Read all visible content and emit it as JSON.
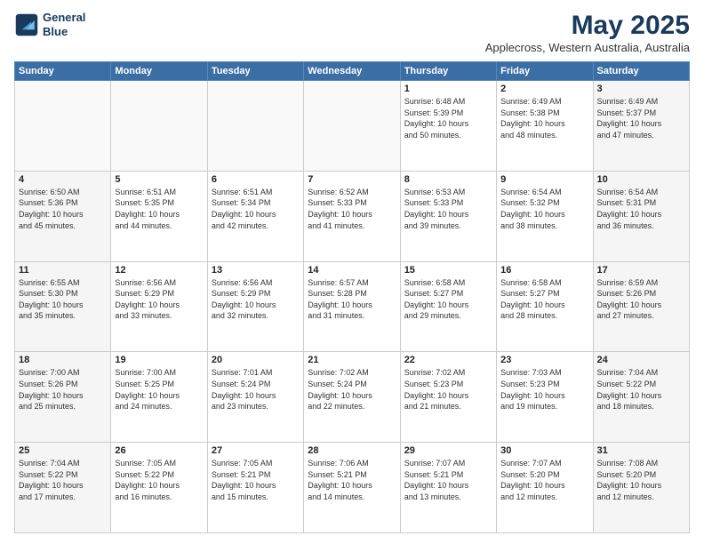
{
  "header": {
    "logo_line1": "General",
    "logo_line2": "Blue",
    "title": "May 2025",
    "location": "Applecross, Western Australia, Australia"
  },
  "weekdays": [
    "Sunday",
    "Monday",
    "Tuesday",
    "Wednesday",
    "Thursday",
    "Friday",
    "Saturday"
  ],
  "weeks": [
    [
      {
        "day": "",
        "type": "empty",
        "info": ""
      },
      {
        "day": "",
        "type": "empty",
        "info": ""
      },
      {
        "day": "",
        "type": "empty",
        "info": ""
      },
      {
        "day": "",
        "type": "empty",
        "info": ""
      },
      {
        "day": "1",
        "type": "weekday",
        "info": "Sunrise: 6:48 AM\nSunset: 5:39 PM\nDaylight: 10 hours\nand 50 minutes."
      },
      {
        "day": "2",
        "type": "weekend",
        "info": "Sunrise: 6:49 AM\nSunset: 5:38 PM\nDaylight: 10 hours\nand 48 minutes."
      },
      {
        "day": "3",
        "type": "weekend",
        "info": "Sunrise: 6:49 AM\nSunset: 5:37 PM\nDaylight: 10 hours\nand 47 minutes."
      }
    ],
    [
      {
        "day": "4",
        "type": "weekend",
        "info": "Sunrise: 6:50 AM\nSunset: 5:36 PM\nDaylight: 10 hours\nand 45 minutes."
      },
      {
        "day": "5",
        "type": "weekday",
        "info": "Sunrise: 6:51 AM\nSunset: 5:35 PM\nDaylight: 10 hours\nand 44 minutes."
      },
      {
        "day": "6",
        "type": "weekday",
        "info": "Sunrise: 6:51 AM\nSunset: 5:34 PM\nDaylight: 10 hours\nand 42 minutes."
      },
      {
        "day": "7",
        "type": "weekday",
        "info": "Sunrise: 6:52 AM\nSunset: 5:33 PM\nDaylight: 10 hours\nand 41 minutes."
      },
      {
        "day": "8",
        "type": "weekday",
        "info": "Sunrise: 6:53 AM\nSunset: 5:33 PM\nDaylight: 10 hours\nand 39 minutes."
      },
      {
        "day": "9",
        "type": "weekend",
        "info": "Sunrise: 6:54 AM\nSunset: 5:32 PM\nDaylight: 10 hours\nand 38 minutes."
      },
      {
        "day": "10",
        "type": "weekend",
        "info": "Sunrise: 6:54 AM\nSunset: 5:31 PM\nDaylight: 10 hours\nand 36 minutes."
      }
    ],
    [
      {
        "day": "11",
        "type": "weekend",
        "info": "Sunrise: 6:55 AM\nSunset: 5:30 PM\nDaylight: 10 hours\nand 35 minutes."
      },
      {
        "day": "12",
        "type": "weekday",
        "info": "Sunrise: 6:56 AM\nSunset: 5:29 PM\nDaylight: 10 hours\nand 33 minutes."
      },
      {
        "day": "13",
        "type": "weekday",
        "info": "Sunrise: 6:56 AM\nSunset: 5:29 PM\nDaylight: 10 hours\nand 32 minutes."
      },
      {
        "day": "14",
        "type": "weekday",
        "info": "Sunrise: 6:57 AM\nSunset: 5:28 PM\nDaylight: 10 hours\nand 31 minutes."
      },
      {
        "day": "15",
        "type": "weekday",
        "info": "Sunrise: 6:58 AM\nSunset: 5:27 PM\nDaylight: 10 hours\nand 29 minutes."
      },
      {
        "day": "16",
        "type": "weekend",
        "info": "Sunrise: 6:58 AM\nSunset: 5:27 PM\nDaylight: 10 hours\nand 28 minutes."
      },
      {
        "day": "17",
        "type": "weekend",
        "info": "Sunrise: 6:59 AM\nSunset: 5:26 PM\nDaylight: 10 hours\nand 27 minutes."
      }
    ],
    [
      {
        "day": "18",
        "type": "weekend",
        "info": "Sunrise: 7:00 AM\nSunset: 5:26 PM\nDaylight: 10 hours\nand 25 minutes."
      },
      {
        "day": "19",
        "type": "weekday",
        "info": "Sunrise: 7:00 AM\nSunset: 5:25 PM\nDaylight: 10 hours\nand 24 minutes."
      },
      {
        "day": "20",
        "type": "weekday",
        "info": "Sunrise: 7:01 AM\nSunset: 5:24 PM\nDaylight: 10 hours\nand 23 minutes."
      },
      {
        "day": "21",
        "type": "weekday",
        "info": "Sunrise: 7:02 AM\nSunset: 5:24 PM\nDaylight: 10 hours\nand 22 minutes."
      },
      {
        "day": "22",
        "type": "weekday",
        "info": "Sunrise: 7:02 AM\nSunset: 5:23 PM\nDaylight: 10 hours\nand 21 minutes."
      },
      {
        "day": "23",
        "type": "weekend",
        "info": "Sunrise: 7:03 AM\nSunset: 5:23 PM\nDaylight: 10 hours\nand 19 minutes."
      },
      {
        "day": "24",
        "type": "weekend",
        "info": "Sunrise: 7:04 AM\nSunset: 5:22 PM\nDaylight: 10 hours\nand 18 minutes."
      }
    ],
    [
      {
        "day": "25",
        "type": "weekend",
        "info": "Sunrise: 7:04 AM\nSunset: 5:22 PM\nDaylight: 10 hours\nand 17 minutes."
      },
      {
        "day": "26",
        "type": "weekday",
        "info": "Sunrise: 7:05 AM\nSunset: 5:22 PM\nDaylight: 10 hours\nand 16 minutes."
      },
      {
        "day": "27",
        "type": "weekday",
        "info": "Sunrise: 7:05 AM\nSunset: 5:21 PM\nDaylight: 10 hours\nand 15 minutes."
      },
      {
        "day": "28",
        "type": "weekday",
        "info": "Sunrise: 7:06 AM\nSunset: 5:21 PM\nDaylight: 10 hours\nand 14 minutes."
      },
      {
        "day": "29",
        "type": "weekday",
        "info": "Sunrise: 7:07 AM\nSunset: 5:21 PM\nDaylight: 10 hours\nand 13 minutes."
      },
      {
        "day": "30",
        "type": "weekend",
        "info": "Sunrise: 7:07 AM\nSunset: 5:20 PM\nDaylight: 10 hours\nand 12 minutes."
      },
      {
        "day": "31",
        "type": "weekend",
        "info": "Sunrise: 7:08 AM\nSunset: 5:20 PM\nDaylight: 10 hours\nand 12 minutes."
      }
    ]
  ]
}
